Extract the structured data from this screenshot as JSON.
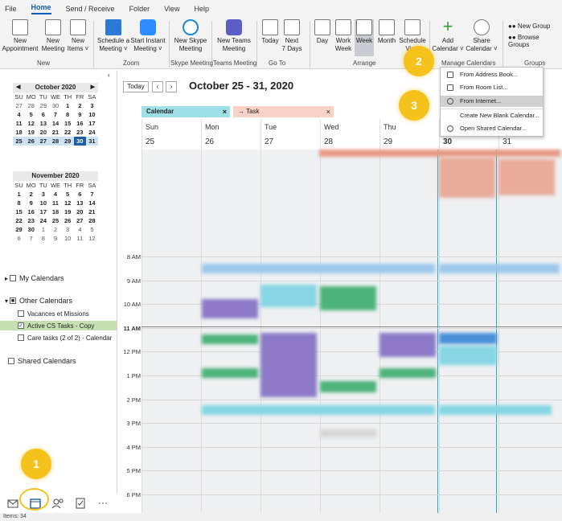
{
  "menu": {
    "items": [
      "File",
      "Home",
      "Send / Receive",
      "Folder",
      "View",
      "Help"
    ],
    "active": "Home"
  },
  "ribbon": {
    "new_appointment": "New\nAppointment",
    "new_meeting": "New\nMeeting",
    "new_items": "New\nItems ˅",
    "schedule_meeting": "Schedule a\nMeeting ˅",
    "start_instant": "Start Instant\nMeeting ˅",
    "new_skype": "New Skype\nMeeting",
    "new_teams": "New Teams\nMeeting",
    "today": "Today",
    "next7": "Next\n7 Days",
    "day": "Day",
    "work_week": "Work\nWeek",
    "week": "Week",
    "month": "Month",
    "schedule_view": "Schedule\nView",
    "add_calendar": "Add\nCalendar ˅",
    "share_calendar": "Share\nCalendar ˅",
    "new_group": "New Group",
    "browse_groups": "Browse Groups",
    "groups": {
      "new": "New",
      "zoom": "Zoom",
      "skype": "Skype Meeting",
      "teams": "Teams Meeting",
      "goto": "Go To",
      "arrange": "Arrange",
      "manage": "Manage Calendars",
      "grp": "Groups"
    }
  },
  "mini_oct": {
    "title": "October 2020",
    "dow": [
      "SU",
      "MO",
      "TU",
      "WE",
      "TH",
      "FR",
      "SA"
    ],
    "weeks": [
      [
        "27",
        "28",
        "29",
        "30",
        "1",
        "2",
        "3"
      ],
      [
        "4",
        "5",
        "6",
        "7",
        "8",
        "9",
        "10"
      ],
      [
        "11",
        "12",
        "13",
        "14",
        "15",
        "16",
        "17"
      ],
      [
        "18",
        "19",
        "20",
        "21",
        "22",
        "23",
        "24"
      ],
      [
        "25",
        "26",
        "27",
        "28",
        "29",
        "30",
        "31"
      ]
    ]
  },
  "mini_nov": {
    "title": "November 2020",
    "dow": [
      "SU",
      "MO",
      "TU",
      "WE",
      "TH",
      "FR",
      "SA"
    ],
    "weeks": [
      [
        "1",
        "2",
        "3",
        "4",
        "5",
        "6",
        "7"
      ],
      [
        "8",
        "9",
        "10",
        "11",
        "12",
        "13",
        "14"
      ],
      [
        "15",
        "16",
        "17",
        "18",
        "19",
        "20",
        "21"
      ],
      [
        "22",
        "23",
        "24",
        "25",
        "26",
        "27",
        "28"
      ],
      [
        "29",
        "30",
        "1",
        "2",
        "3",
        "4",
        "5"
      ],
      [
        "6",
        "7",
        "8",
        "9",
        "10",
        "11",
        "12"
      ]
    ]
  },
  "folders": {
    "my_calendars": "My Calendars",
    "other_calendars": "Other Calendars",
    "vacances": "Vacances et Missions",
    "active_cs": "Active CS Tasks - Copy",
    "care_tasks": "Care tasks (2 of 2) - Calendar",
    "shared": "Shared Calendars"
  },
  "status": "Items: 34",
  "calendar": {
    "today_btn": "Today",
    "range": "October 25 - 31, 2020",
    "tab_calendar": "Calendar",
    "tab_task": "→  Task",
    "days": [
      "Sun",
      "Mon",
      "Tue",
      "Wed",
      "Thu",
      "Fri",
      "Sat"
    ],
    "dates": [
      "25",
      "26",
      "27",
      "28",
      "29",
      "30",
      "31"
    ],
    "times": [
      "8 AM",
      "9 AM",
      "10 AM",
      "11 AM",
      "12 PM",
      "1 PM",
      "2 PM",
      "3 PM",
      "4 PM",
      "5 PM",
      "6 PM"
    ]
  },
  "dropdown": {
    "address_book": "From Address Book...",
    "room_list": "From Room List...",
    "internet": "From Internet...",
    "new_blank": "Create New Blank Calendar...",
    "open_shared": "Open Shared Calendar..."
  },
  "callouts": [
    "1",
    "2",
    "3"
  ],
  "colors": {
    "accent": "#1b5fa8",
    "callout": "#f5c21b",
    "selected_folder": "#c6e0b4",
    "calendar_tab": "#9fdfe8",
    "task_tab": "#f9d2c7"
  }
}
